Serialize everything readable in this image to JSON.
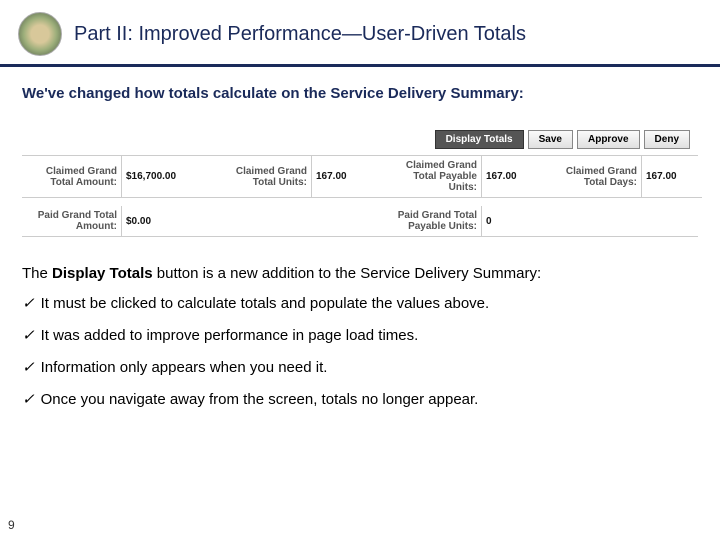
{
  "header": {
    "title": "Part II: Improved Performance—User-Driven Totals"
  },
  "intro": "We've changed how totals calculate on the Service Delivery Summary:",
  "ui": {
    "buttons": {
      "display_totals": "Display Totals",
      "save": "Save",
      "approve": "Approve",
      "deny": "Deny"
    },
    "labels": {
      "claimed_grand_total_amount": "Claimed Grand Total Amount:",
      "claimed_grand_total_units": "Claimed Grand Total Units:",
      "claimed_grand_total_payable_units": "Claimed Grand Total Payable Units:",
      "claimed_grand_total_days": "Claimed Grand Total Days:",
      "paid_grand_total_amount": "Paid Grand Total Amount:",
      "paid_grand_total_payable_units": "Paid Grand Total Payable Units:"
    },
    "values": {
      "claimed_grand_total_amount": "$16,700.00",
      "claimed_grand_total_units": "167.00",
      "claimed_grand_total_payable_units": "167.00",
      "claimed_grand_total_days": "167.00",
      "paid_grand_total_amount": "$0.00",
      "paid_grand_total_payable_units": "0"
    }
  },
  "explain_pre": "The ",
  "explain_strong": "Display Totals",
  "explain_post": " button is a new addition to the Service Delivery Summary:",
  "bullets": {
    "b1": "It must be clicked to calculate totals and populate the values above.",
    "b2": "It was added to improve performance in page load times.",
    "b3": "Information only appears when you need it.",
    "b4": "Once you navigate away from the screen, totals no longer appear."
  },
  "page_number": "9"
}
